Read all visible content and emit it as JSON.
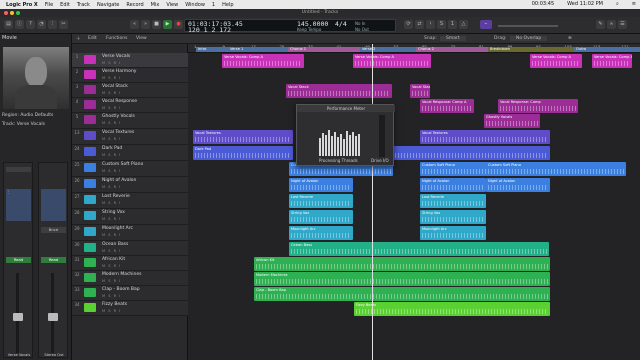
{
  "menubar": {
    "app": "Logic Pro X",
    "items": [
      "File",
      "Edit",
      "Track",
      "Navigate",
      "Record",
      "Mix",
      "View",
      "Window",
      "1",
      "Help"
    ],
    "clock": "Wed 11:02 PM",
    "timer": "00:03:45"
  },
  "window": {
    "title": "Untitled - Tracks"
  },
  "lcd": {
    "time": "01:03:17:03.45",
    "bars": "120  1  2  172",
    "tempo": "145.0000",
    "tempo_label": "Keep Tempo",
    "signature": "4/4",
    "key": "No In",
    "key2": "No Out"
  },
  "inspector": {
    "header": "Movie",
    "region_label": "Region: Audio Defaults",
    "track_label": "Track: Verse Vocals",
    "strip1_name": "Verse Vocals",
    "strip2_name": "Stereo Out",
    "read1": "Read",
    "read2": "Read",
    "bnce": "Bnce"
  },
  "tracklist_toolbar": {
    "edit": "Edit",
    "functions": "Functions",
    "view": "View"
  },
  "arrange_toolbar": {
    "snap_label": "Snap:",
    "snap": "Smart",
    "drag_label": "Drag:",
    "drag": "No Overlap"
  },
  "colors": {
    "vocal_main": "#c832b8",
    "vocal_alt": "#9c2d96",
    "texture": "#5e4cc9",
    "pad": "#4b5bd6",
    "keys": "#3b7fe0",
    "strings": "#2fa8c9",
    "bass": "#22b088",
    "drums": "#2fb052",
    "lead": "#5ad032"
  },
  "ruler_numbers": [
    "1",
    "9",
    "17",
    "25",
    "33",
    "41",
    "49",
    "57",
    "65",
    "73",
    "81",
    "89",
    "97",
    "105",
    "113",
    "121"
  ],
  "markers": [
    {
      "label": "Intro"
    },
    {
      "label": "Verse 1"
    },
    {
      "label": "Chorus 1"
    },
    {
      "label": "Verse 2"
    },
    {
      "label": "Chorus 2"
    },
    {
      "label": "Breakdown"
    },
    {
      "label": "Outro"
    }
  ],
  "tracks": [
    {
      "num": "1",
      "name": "Verse Vocals"
    },
    {
      "num": "2",
      "name": "Verse Harmony"
    },
    {
      "num": "3",
      "name": "Vocal Stack"
    },
    {
      "num": "4",
      "name": "Vocal Response"
    },
    {
      "num": "5",
      "name": "Ghostly Vocals"
    },
    {
      "num": "13",
      "name": "Vocal Textures"
    },
    {
      "num": "24",
      "name": "Dark Pad"
    },
    {
      "num": "25",
      "name": "Custom Soft Piano"
    },
    {
      "num": "26",
      "name": "Night of Avalon"
    },
    {
      "num": "27",
      "name": "Lost Reverie"
    },
    {
      "num": "28",
      "name": "String Vox"
    },
    {
      "num": "29",
      "name": "Moonlight Arc"
    },
    {
      "num": "30",
      "name": "Ocean Bass"
    },
    {
      "num": "31",
      "name": "African Kit"
    },
    {
      "num": "32",
      "name": "Modern Machines"
    },
    {
      "num": "33",
      "name": "Clap - Boom Bap"
    },
    {
      "num": "34",
      "name": "Fizzy Beats"
    }
  ],
  "regions": [
    {
      "label": "Verse Vocals: Comp A"
    },
    {
      "label": "Verse Vocals: Comp A"
    },
    {
      "label": "Vocal Stack"
    },
    {
      "label": "Vocal Response: Comp A"
    },
    {
      "label": "Vocal Response: Comp"
    },
    {
      "label": "Ghostly Vocals"
    },
    {
      "label": "Vocal Textures"
    },
    {
      "label": "Dark Pad"
    },
    {
      "label": "Custom Soft Piano"
    },
    {
      "label": "Night of Avalon"
    },
    {
      "label": "Lost Reverie"
    },
    {
      "label": "String Vox"
    },
    {
      "label": "Moonlight Arc"
    },
    {
      "label": "Ocean Bass"
    },
    {
      "label": "African Kit"
    },
    {
      "label": "Modern Machines"
    },
    {
      "label": "Clap - Boom Bap"
    },
    {
      "label": "Fizzy Beats"
    }
  ],
  "perf": {
    "title": "Performance Meter",
    "threads_label": "Processing Threads",
    "drive_label": "Drive I/O",
    "thread_levels": [
      0.42,
      0.55,
      0.5,
      0.62,
      0.48,
      0.58,
      0.45,
      0.52,
      0.4,
      0.6,
      0.5,
      0.56,
      0.47,
      0.53
    ],
    "drive_level": 0.05
  }
}
